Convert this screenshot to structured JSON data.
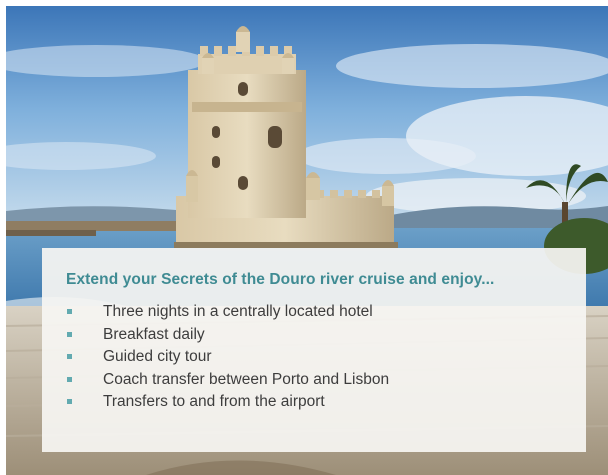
{
  "promo": {
    "heading": "Extend your Secrets of the Douro river cruise and enjoy...",
    "items": [
      "Three nights in a centrally located hotel",
      "Breakfast daily",
      "Guided city tour",
      "Coach transfer between Porto and Lisbon",
      "Transfers to and from the airport"
    ]
  },
  "colors": {
    "heading": "#3f8b93",
    "bullet": "#62aab0",
    "body_text": "#3d3d3d",
    "card_bg": "#f6f5f2",
    "sky": "#5f93c8"
  }
}
